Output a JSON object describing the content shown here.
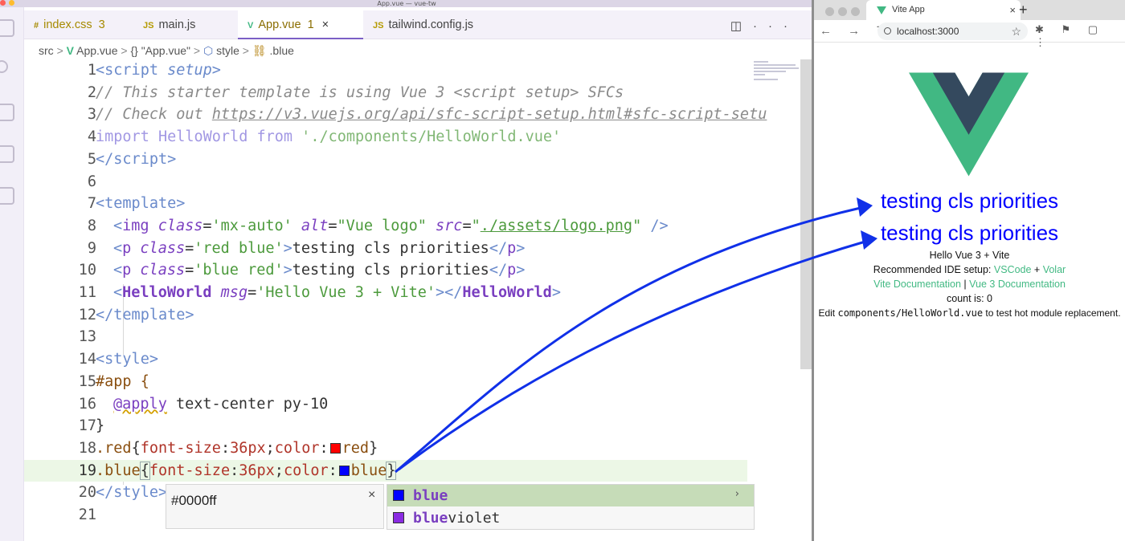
{
  "window": {
    "title": "App.vue — vue-tw"
  },
  "tabs": [
    {
      "icon": "#",
      "label": "index.css",
      "count": "3",
      "color": "#a68a00"
    },
    {
      "icon": "JS",
      "label": "main.js",
      "count": "",
      "color": "#b59a00"
    },
    {
      "icon": "V",
      "label": "App.vue",
      "count": "1",
      "color": "#41b883",
      "active": true
    },
    {
      "icon": "JS",
      "label": "tailwind.config.js",
      "count": "",
      "color": "#b59a00"
    }
  ],
  "tab_tools": {
    "split": "◫",
    "more": "···"
  },
  "breadcrumb": {
    "p1": "src",
    "sep": ">",
    "p2": "App.vue",
    "p3": "{} \"App.vue\"",
    "p4": "style",
    "p5": ".blue"
  },
  "code": {
    "numbers": [
      "1",
      "2",
      "3",
      "4",
      "5",
      "6",
      "7",
      "8",
      "9",
      "10",
      "11",
      "12",
      "13",
      "14",
      "15",
      "16",
      "17",
      "18",
      "19",
      "20",
      "21"
    ],
    "l1": {
      "a": "<",
      "b": "script",
      "c": " setup",
      "d": ">"
    },
    "l2": "// This starter template is using Vue 3 <script setup> SFCs",
    "l3": {
      "a": "// Check out ",
      "b": "https://v3.vuejs.org/api/sfc-script-setup.html#sfc-script-setu"
    },
    "l4": {
      "a": "import",
      "b": " HelloWorld ",
      "c": "from",
      "d": " './components/HelloWorld.vue'"
    },
    "l5": {
      "a": "</",
      "b": "script",
      "c": ">"
    },
    "l7": {
      "a": "<",
      "b": "template",
      "c": ">"
    },
    "l8": {
      "a": "<",
      "b": "img",
      "c": " class",
      "d": "=",
      "e": "'mx-auto'",
      "f": " alt",
      "g": "=",
      "h": "\"Vue logo\"",
      "i": " src",
      "j": "=",
      "k": "\"",
      "l": "./assets/logo.png",
      "m": "\"",
      "n": " />"
    },
    "l9": {
      "a": "<",
      "b": "p",
      "c": " class",
      "d": "=",
      "e": "'red blue'",
      "f": ">",
      "g": "testing cls priorities",
      "h": "</",
      "i": "p",
      "j": ">"
    },
    "l10": {
      "a": "<",
      "b": "p",
      "c": " class",
      "d": "=",
      "e": "'blue red'",
      "f": ">",
      "g": "testing cls priorities",
      "h": "</",
      "i": "p",
      "j": ">"
    },
    "l11": {
      "a": "<",
      "b": "HelloWorld",
      "c": " msg",
      "d": "=",
      "e": "'Hello Vue 3 + Vite'",
      "f": "></",
      "g": "HelloWorld",
      "h": ">"
    },
    "l12": {
      "a": "</",
      "b": "template",
      "c": ">"
    },
    "l14": {
      "a": "<",
      "b": "style",
      "c": ">"
    },
    "l15": "#app {",
    "l16": {
      "a": "@apply",
      "b": " text-center py-10"
    },
    "l17": "}",
    "l18": {
      "a": ".red",
      "b": "{",
      "c": "font-size",
      "d": ":",
      "e": "36px",
      "f": ";",
      "g": "color",
      "h": ":",
      "i": "red",
      "j": "}",
      "swatch": "#ff0000"
    },
    "l19": {
      "a": ".blue",
      "b": "{",
      "c": "font-size",
      "d": ":",
      "e": "36px",
      "f": ";",
      "g": "color",
      "h": ":",
      "i": "blue",
      "j": "}",
      "swatch": "#0000ff"
    },
    "l20": {
      "a": "</",
      "b": "style",
      "c": ">"
    }
  },
  "hover": {
    "value": "#0000ff",
    "close": "×"
  },
  "suggestions": [
    {
      "match": "blue",
      "rest": "",
      "color": "#0000ff"
    },
    {
      "match": "blue",
      "rest": "violet",
      "color": "#8a2be2"
    }
  ],
  "browser": {
    "tab_title": "Vite App",
    "tab_close": "×",
    "new_tab": "+",
    "url": "localhost:3000",
    "nav": "← → ↻",
    "star": "☆",
    "extensions": "✱ ⚑ ▢ ⋮"
  },
  "app": {
    "p1": "testing cls priorities",
    "p2": "testing cls priorities",
    "hello": "Hello Vue 3 + Vite",
    "ide_text": "Recommended IDE setup: ",
    "vscode": "VSCode",
    "plus": " + ",
    "volar": "Volar",
    "vite_docs": "Vite Documentation",
    "pipe": " | ",
    "vue_docs": "Vue 3 Documentation",
    "count": "count is: 0",
    "edit1": "Edit ",
    "edit_code": "components/HelloWorld.vue",
    "edit2": " to test hot module replacement."
  },
  "colors": {
    "accent": "#7b5fc6",
    "vue_green": "#41b883",
    "vue_dark": "#35495e",
    "arrow": "#1030e8",
    "tag": "#7a3fc0",
    "string": "#4c9a3c"
  }
}
